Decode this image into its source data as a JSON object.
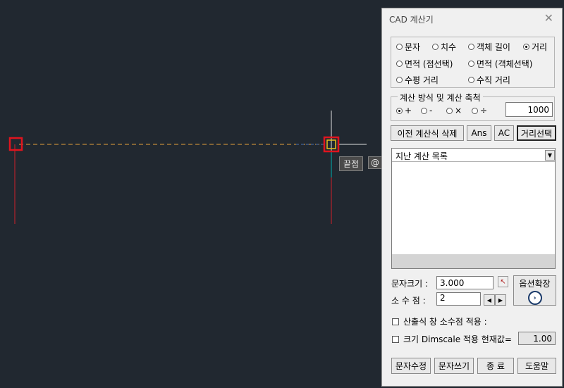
{
  "canvas": {
    "snap_label": "끝점",
    "snap_label2": "@"
  },
  "dialog": {
    "title": "CAD 계산기",
    "close": "✕",
    "measure_options": [
      {
        "label": "문자",
        "checked": false
      },
      {
        "label": "치수",
        "checked": false
      },
      {
        "label": "객체 길이",
        "checked": false
      },
      {
        "label": "거리",
        "checked": true
      },
      {
        "label": "면적 (점선택)",
        "checked": false
      },
      {
        "label": "면적 (객체선택)",
        "checked": false
      },
      {
        "label": "수평 거리",
        "checked": false
      },
      {
        "label": "수직 거리",
        "checked": false
      }
    ],
    "calc_group_title": "계산 방식 및 계산 축척",
    "operators": [
      {
        "label": "+",
        "checked": true
      },
      {
        "label": "-",
        "checked": false
      },
      {
        "label": "×",
        "checked": false
      },
      {
        "label": "÷",
        "checked": false
      }
    ],
    "scale_value": "1000",
    "buttons": {
      "delete_prev": "이전 계산식 삭제",
      "ans": "Ans",
      "ac": "AC",
      "distance_select": "거리선택"
    },
    "history_label": "지난 계산 목록",
    "text_size_label": "문자크기 :",
    "text_size_value": "3.000",
    "decimal_label": "소 수  점 :",
    "decimal_value": "2",
    "option_expand": "옵션확장",
    "check_decimal": "산출식 창 소수점 적용 :",
    "check_dimscale": "크기 Dimscale 적용  현재값=",
    "current_value": "1.00",
    "bottom_buttons": {
      "edit_text": "문자수정",
      "write_text": "문자쓰기",
      "exit": "종 료",
      "help": "도움말"
    }
  }
}
